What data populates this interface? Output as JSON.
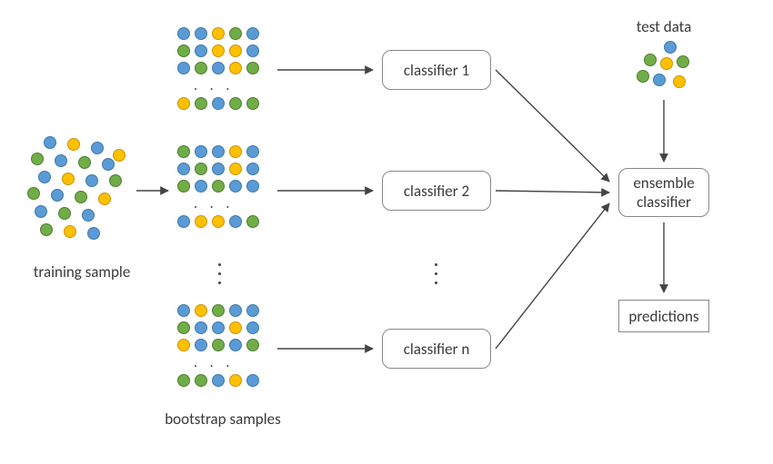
{
  "labels": {
    "training_sample": "training sample",
    "bootstrap_samples": "bootstrap samples",
    "test_data": "test data"
  },
  "boxes": {
    "classifier1": "classifier 1",
    "classifier2": "classifier 2",
    "classifier_n": "classifier n",
    "ensemble": "ensemble\nclassifier",
    "predictions": "predictions"
  },
  "colors": {
    "blue": "#5b9bd5",
    "green": "#70ad47",
    "yellow": "#ffc000"
  },
  "flow": [
    "training sample → bootstrap samples",
    "bootstrap samples → classifier 1..n",
    "classifier 1..n → ensemble classifier",
    "test data → ensemble classifier",
    "ensemble classifier → predictions"
  ]
}
